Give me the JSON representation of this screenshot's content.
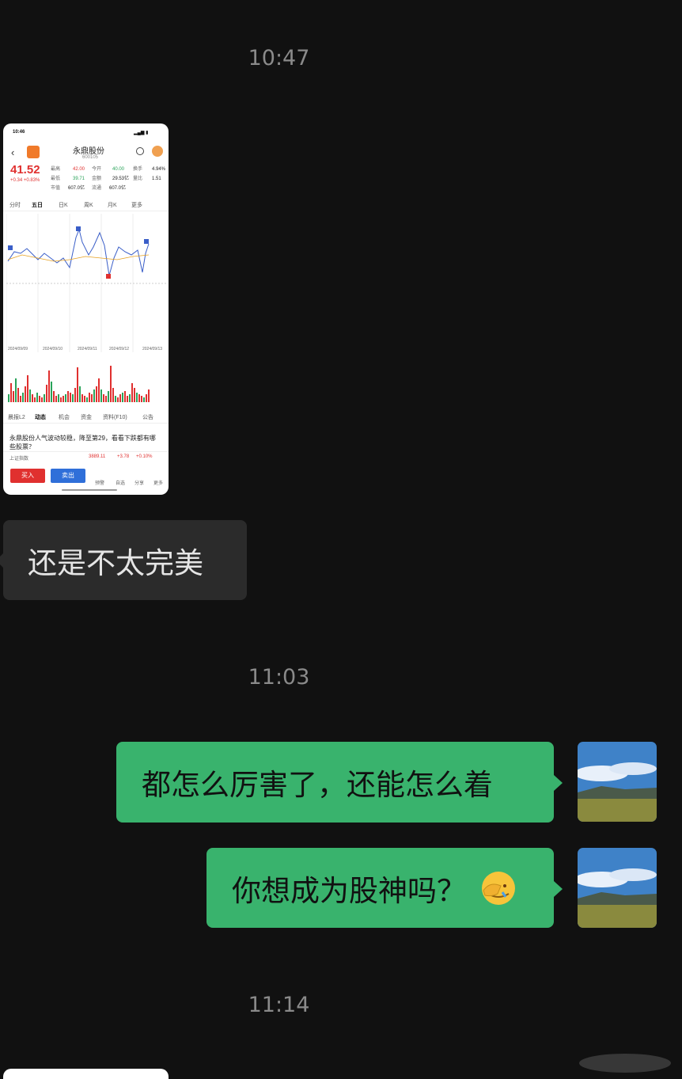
{
  "timestamps": [
    "10:47",
    "11:03",
    "11:14"
  ],
  "shared_screenshot": {
    "status_time": "10:46",
    "stock_name": "永鼎股份",
    "stock_code": "600105",
    "price": "41.52",
    "change": "+0.34 +0.83%",
    "quote_fields": [
      {
        "k": "最高",
        "v": "42.00"
      },
      {
        "k": "今开",
        "v": "40.00"
      },
      {
        "k": "换手",
        "v": "4.94%"
      },
      {
        "k": "最低",
        "v": "39.71"
      },
      {
        "k": "金额",
        "v": "29.53亿"
      },
      {
        "k": "量比",
        "v": "1.51"
      },
      {
        "k": "市值",
        "v": "607.0亿"
      },
      {
        "k": "流通",
        "v": "607.0亿"
      }
    ],
    "period_tabs": [
      "分时",
      "五日",
      "日K",
      "周K",
      "月K",
      "更多"
    ],
    "bottom_tabs": [
      "晨报L2",
      "动态",
      "机会",
      "资金",
      "资料(F10)",
      "公告"
    ],
    "news_text": "永鼎股份人气波动较稳，降至第29，看看下跌都有哪些股票？",
    "index_name": "上证指数",
    "index_value": "3889.11",
    "index_change": "+3.78",
    "index_pct": "+0.10%",
    "buy_label": "买入",
    "sell_label": "卖出",
    "action_icons": [
      "预警",
      "自选",
      "分享",
      "更多"
    ],
    "chart_dates": [
      "2024/09/09",
      "2024/09/10",
      "2024/09/11",
      "2024/09/12",
      "2024/09/13"
    ]
  },
  "messages": {
    "received_1": "还是不太完美",
    "sent_1": "都怎么厉害了，还能怎么着",
    "sent_2": "你想成为股神吗？"
  },
  "colors": {
    "background": "#111111",
    "received_bubble": "#2b2b2b",
    "sent_bubble": "#39b36d",
    "timestamp": "#8a8a8a",
    "stock_red": "#e0302f",
    "stock_green": "#2aa35a"
  },
  "icons": [
    "back-arrow-icon",
    "search-icon",
    "avatar-icon",
    "facepalm-emoji-icon"
  ]
}
